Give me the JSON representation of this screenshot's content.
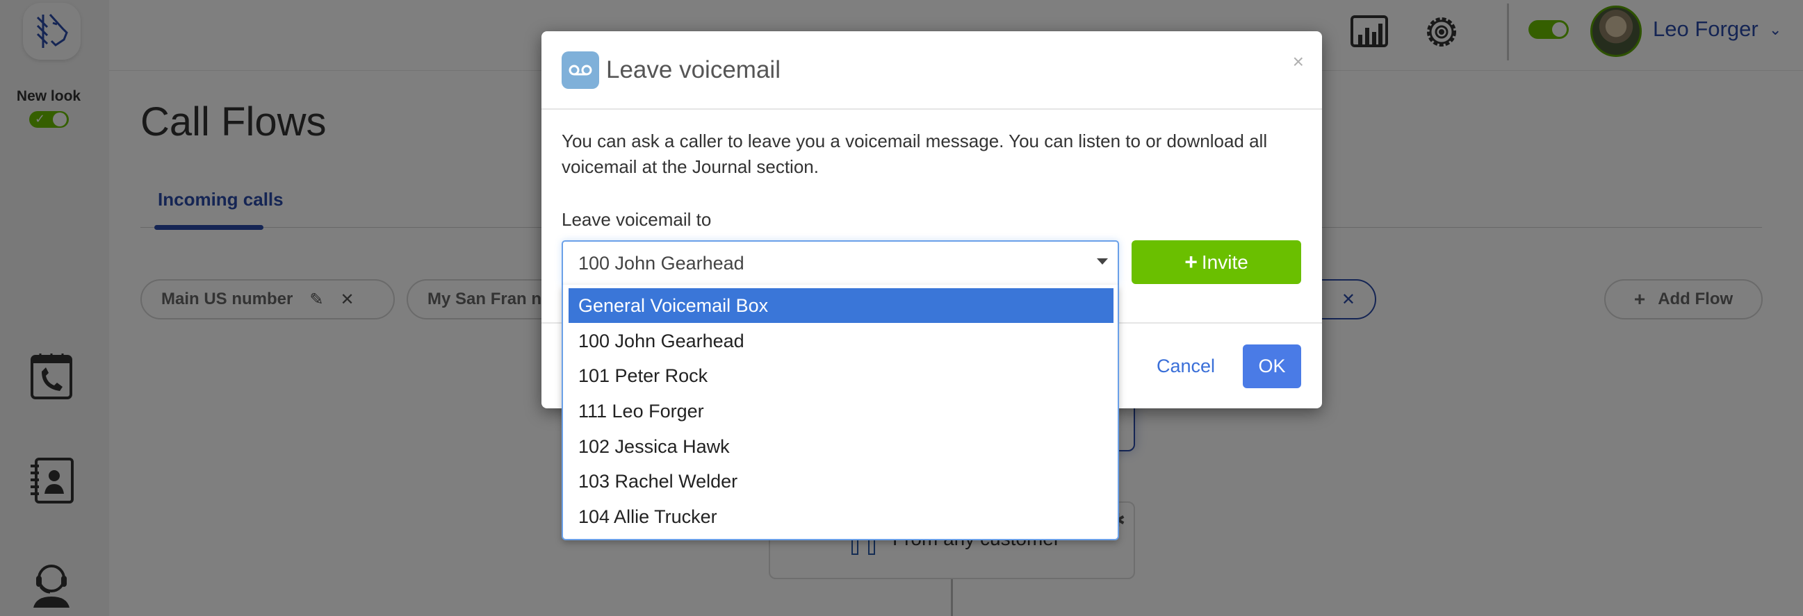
{
  "sidebar": {
    "new_look_label": "New look",
    "new_look_enabled": true,
    "icons": [
      "call-journal-icon",
      "contacts-book-icon",
      "operator-headset-icon"
    ]
  },
  "topbar": {
    "user_name": "Leo Forger",
    "status_toggle_on": true
  },
  "page": {
    "title": "Call Flows",
    "tabs": [
      {
        "label": "Incoming calls",
        "active": true
      }
    ],
    "chips": [
      {
        "label": "Main US number"
      },
      {
        "label": "My San Fran n"
      }
    ],
    "add_flow_label": "Add Flow",
    "flow_card_text": "From any customer"
  },
  "modal": {
    "title": "Leave voicemail",
    "close_label": "×",
    "description": "You can ask a caller to leave you a voicemail message. You can listen to or download all voicemail at the Journal section.",
    "field_label": "Leave voicemail to",
    "selected_value": "100 John Gearhead",
    "invite_label": "Invite",
    "cancel_label": "Cancel",
    "ok_label": "OK",
    "options": [
      {
        "label": "General Voicemail Box",
        "highlighted": true
      },
      {
        "label": "100 John Gearhead"
      },
      {
        "label": "101 Peter Rock"
      },
      {
        "label": "111 Leo Forger"
      },
      {
        "label": "102 Jessica Hawk"
      },
      {
        "label": "103 Rachel Welder"
      },
      {
        "label": "104 Allie Trucker"
      }
    ]
  },
  "colors": {
    "brand_blue": "#2a4aa8",
    "toggle_green": "#6abf00",
    "invite_green": "#6abf00",
    "ok_blue": "#4a7be6",
    "option_highlight": "#3a76d8",
    "voicemail_icon_bg": "#7fb0d9"
  }
}
